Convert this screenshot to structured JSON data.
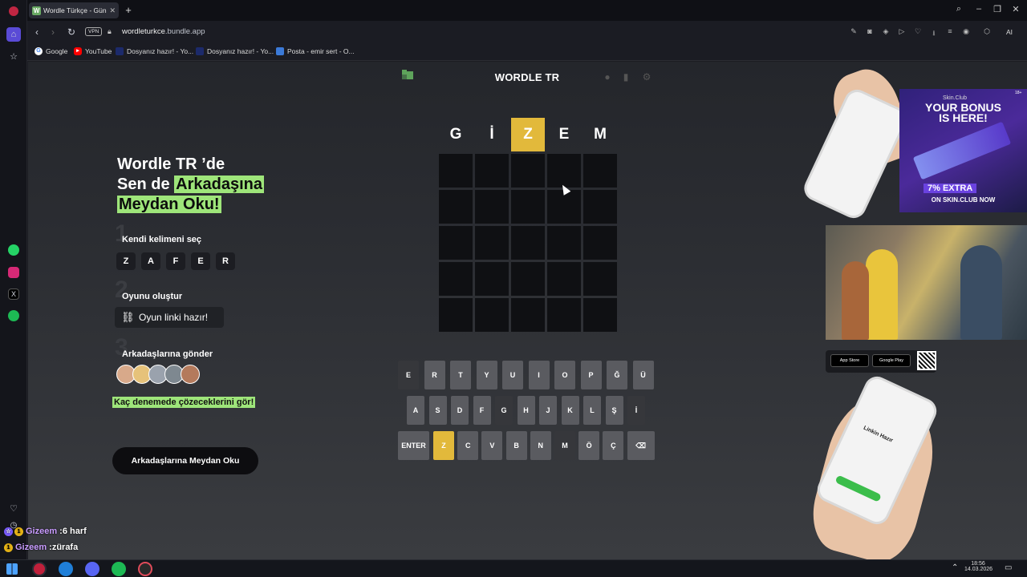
{
  "browser": {
    "tab_title": "Wordle Türkçe - Günlük K",
    "tab_favicon_letter": "W",
    "url_domain": "wordleturkce",
    "url_rest": ".bundle.app",
    "vpn_label": "VPN",
    "ai_label": "AI",
    "bookmarks": [
      "Google",
      "YouTube",
      "Dosyanız hazır! - Yo...",
      "Dosyanız hazır! - Yo...",
      "Posta - emir sert - O..."
    ]
  },
  "game": {
    "title": "WORDLE TR",
    "top_word": [
      "G",
      "İ",
      "Z",
      "E",
      "M"
    ],
    "top_word_states": [
      "",
      "",
      "present",
      "",
      ""
    ],
    "keyboard_rows": [
      [
        "E",
        "R",
        "T",
        "Y",
        "U",
        "I",
        "O",
        "P",
        "Ğ",
        "Ü"
      ],
      [
        "A",
        "S",
        "D",
        "F",
        "G",
        "H",
        "J",
        "K",
        "L",
        "Ş",
        "İ"
      ],
      [
        "ENTER",
        "Z",
        "C",
        "V",
        "B",
        "N",
        "M",
        "Ö",
        "Ç",
        "⌫"
      ]
    ]
  },
  "promo": {
    "title_line1": "Wordle TR ’de",
    "title_line2_plain": "Sen de ",
    "title_line2_hl": "Arkadaşına",
    "title_line3_hl": "Meydan Oku!",
    "step1_num": "1",
    "step1_label": "Kendi kelimeni seç",
    "step1_letters": [
      "Z",
      "A",
      "F",
      "E",
      "R"
    ],
    "step2_num": "2",
    "step2_label": "Oyunu oluştur",
    "step2_pill": "Oyun linki hazır!",
    "step3_num": "3",
    "step3_label": "Arkadaşlarına gönder",
    "note": "Kaç denemede çözeceklerini gör!",
    "cta": "Arkadaşlarına Meydan Oku"
  },
  "ads": {
    "ad1_brand": "Skin.Club",
    "ad1_badge": "18+",
    "ad1_line1": "YOUR BONUS",
    "ad1_line2": "IS HERE!",
    "ad1_extra": "7% EXTRA",
    "ad1_store": "ON SKIN.CLUB NOW",
    "appstore": "App Store",
    "googleplay": "Google Play",
    "phone_text": "Linkin Hazır"
  },
  "chat": [
    {
      "name": "Gizeem",
      "sep": " : ",
      "msg": "6 harf"
    },
    {
      "name": "Gizeem",
      "sep": " : ",
      "msg": "zürafa"
    }
  ],
  "taskbar": {
    "time": "18:56",
    "date": "14.03.2026"
  },
  "colors": {
    "present": "#e2b93b",
    "highlight": "#9ee57a",
    "logo_green": "#5ea35b"
  }
}
